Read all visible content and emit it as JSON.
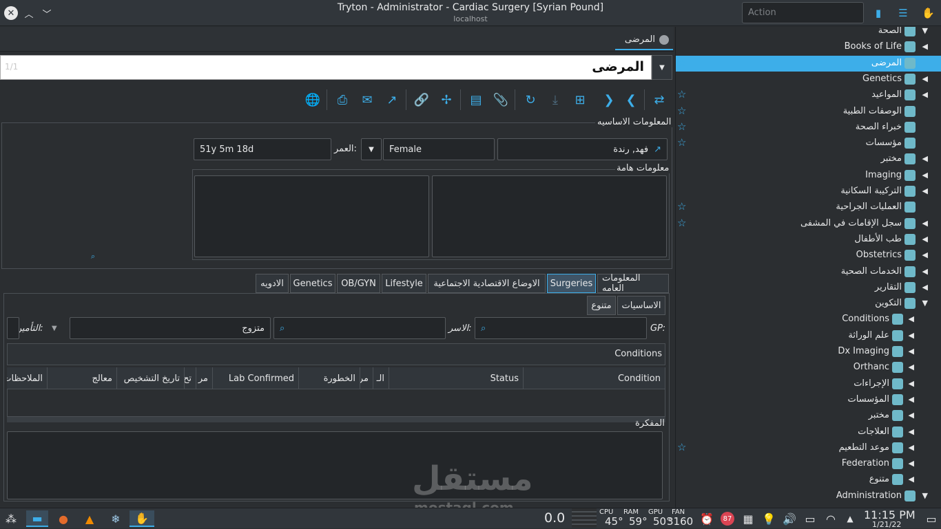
{
  "window": {
    "title": "Tryton - Administrator - Cardiac Surgery [Syrian Pound]",
    "subtitle": "localhost",
    "action_placeholder": "Action"
  },
  "tab": {
    "label": "المرضى"
  },
  "search": {
    "title": "المرضى",
    "count": "1/1"
  },
  "basic_info": {
    "group_label": "المعلومات الاساسيه",
    "patient_name": "فهد, رندة",
    "gender": "Female",
    "age_label": "العمر:",
    "age": "51y 5m 18d",
    "important_label": "معلومات هامة"
  },
  "tabs": [
    "المعلومات العامه",
    "Surgeries",
    "الاوضاع الاقتصادية الاجتماعية",
    "Lifestyle",
    "OB/GYN",
    "Genetics",
    "الادويه"
  ],
  "subtabs": [
    "الاساسيات",
    "متنوع"
  ],
  "general": {
    "gp_label": "GP:",
    "family_label": "الاسر:",
    "marital_value": "متزوج",
    "insurance_label": "التأمين:"
  },
  "conditions": {
    "title": "Conditions",
    "columns": [
      "Condition",
      "Status",
      "الـ",
      "مر",
      "الخطورة",
      "Lab Confirmed",
      "مر",
      "تح",
      "تاريخ التشخيص",
      "معالج",
      "الملاحظات"
    ]
  },
  "memo": {
    "label": "المفكرة"
  },
  "sidebar": {
    "items": [
      {
        "label": "الصحة",
        "arrow": "▼",
        "star": false
      },
      {
        "label": "Books of Life",
        "arrow": "◀",
        "star": false
      },
      {
        "label": "المرضى",
        "arrow": "",
        "star": true,
        "selected": true
      },
      {
        "label": "Genetics",
        "arrow": "◀",
        "star": false
      },
      {
        "label": "المواعيد",
        "arrow": "◀",
        "star": true
      },
      {
        "label": "الوصفات الطبية",
        "arrow": "",
        "star": true
      },
      {
        "label": "خبراء الصحة",
        "arrow": "",
        "star": true
      },
      {
        "label": "مؤسسات",
        "arrow": "",
        "star": true
      },
      {
        "label": "مختبر",
        "arrow": "◀",
        "star": false
      },
      {
        "label": "Imaging",
        "arrow": "◀",
        "star": false
      },
      {
        "label": "التركيبة السكانية",
        "arrow": "◀",
        "star": false
      },
      {
        "label": "العمليات الجراحية",
        "arrow": "",
        "star": true
      },
      {
        "label": "سجل الإقامات في المشفى",
        "arrow": "◀",
        "star": true
      },
      {
        "label": "طب الأطفال",
        "arrow": "◀",
        "star": false
      },
      {
        "label": "Obstetrics",
        "arrow": "◀",
        "star": false
      },
      {
        "label": "الخدمات الصحية",
        "arrow": "◀",
        "star": false
      },
      {
        "label": "التقارير",
        "arrow": "◀",
        "star": false
      },
      {
        "label": "التكوين",
        "arrow": "▼",
        "star": false
      },
      {
        "label": "Conditions",
        "arrow": "◀",
        "star": false,
        "sub": true
      },
      {
        "label": "علم الوراثة",
        "arrow": "◀",
        "star": false,
        "sub": true
      },
      {
        "label": "Dx Imaging",
        "arrow": "◀",
        "star": false,
        "sub": true
      },
      {
        "label": "Orthanc",
        "arrow": "◀",
        "star": false,
        "sub": true
      },
      {
        "label": "الإجراءات",
        "arrow": "◀",
        "star": false,
        "sub": true
      },
      {
        "label": "المؤسسات",
        "arrow": "◀",
        "star": false,
        "sub": true
      },
      {
        "label": "مختبر",
        "arrow": "◀",
        "star": false,
        "sub": true
      },
      {
        "label": "العلاجات",
        "arrow": "◀",
        "star": false,
        "sub": true
      },
      {
        "label": "موعد التطعيم",
        "arrow": "◀",
        "star": true,
        "sub": true
      },
      {
        "label": "Federation",
        "arrow": "◀",
        "star": false,
        "sub": true
      },
      {
        "label": "متنوع",
        "arrow": "◀",
        "star": false,
        "sub": true
      },
      {
        "label": "Administration",
        "arrow": "▼",
        "star": false
      }
    ]
  },
  "panel": {
    "net": "0.0",
    "cpu_label": "CPU",
    "cpu": "45°",
    "ram_label": "RAM",
    "ram": "59°",
    "gpu_label": "GPU",
    "gpu": "50°",
    "fan_label": "FAN",
    "fan": "3160",
    "badge": "87",
    "time": "11:15 PM",
    "date": "1/21/22"
  },
  "watermark": {
    "text": "مستقل",
    "sub": "mostaql.com"
  }
}
